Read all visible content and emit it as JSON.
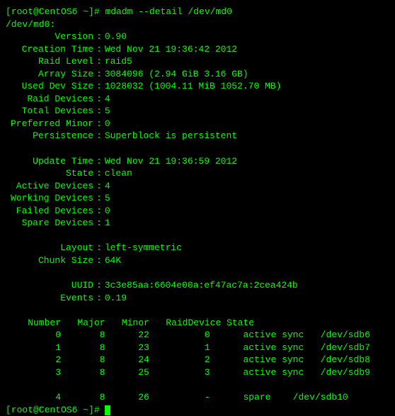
{
  "prompt1": {
    "user_host": "[root@CentOS6 ~]#",
    "command": "mdadm --detail /dev/md0"
  },
  "device_header": "/dev/md0:",
  "fields": {
    "version": {
      "label": "Version",
      "value": "0.90"
    },
    "creation_time": {
      "label": "Creation Time",
      "value": "Wed Nov 21 19:36:42 2012"
    },
    "raid_level": {
      "label": "Raid Level",
      "value": "raid5"
    },
    "array_size": {
      "label": "Array Size",
      "value": "3084096 (2.94 GiB 3.16 GB)"
    },
    "used_dev_size": {
      "label": "Used Dev Size",
      "value": "1028032 (1004.11 MiB 1052.70 MB)"
    },
    "raid_devices": {
      "label": "Raid Devices",
      "value": "4"
    },
    "total_devices": {
      "label": "Total Devices",
      "value": "5"
    },
    "preferred_minor": {
      "label": "Preferred Minor",
      "value": "0"
    },
    "persistence": {
      "label": "Persistence",
      "value": "Superblock is persistent"
    },
    "update_time": {
      "label": "Update Time",
      "value": "Wed Nov 21 19:36:59 2012"
    },
    "state": {
      "label": "State",
      "value": "clean"
    },
    "active_devices": {
      "label": "Active Devices",
      "value": "4"
    },
    "working_devices": {
      "label": "Working Devices",
      "value": "5"
    },
    "failed_devices": {
      "label": "Failed Devices",
      "value": "0"
    },
    "spare_devices": {
      "label": "Spare Devices",
      "value": "1"
    },
    "layout": {
      "label": "Layout",
      "value": "left-symmetric"
    },
    "chunk_size": {
      "label": "Chunk Size",
      "value": "64K"
    },
    "uuid": {
      "label": "UUID",
      "value": "3c3e85aa:6604e00a:ef47ac7a:2cea424b"
    },
    "events": {
      "label": "Events",
      "value": "0.19"
    }
  },
  "table": {
    "headers": {
      "number": "Number",
      "major": "Major",
      "minor": "Minor",
      "raid_device": "RaidDevice",
      "state": "State"
    },
    "rows": [
      {
        "number": "0",
        "major": "8",
        "minor": "22",
        "raid_device": "0",
        "state": "active sync",
        "dev": "/dev/sdb6"
      },
      {
        "number": "1",
        "major": "8",
        "minor": "23",
        "raid_device": "1",
        "state": "active sync",
        "dev": "/dev/sdb7"
      },
      {
        "number": "2",
        "major": "8",
        "minor": "24",
        "raid_device": "2",
        "state": "active sync",
        "dev": "/dev/sdb8"
      },
      {
        "number": "3",
        "major": "8",
        "minor": "25",
        "raid_device": "3",
        "state": "active sync",
        "dev": "/dev/sdb9"
      }
    ],
    "spare_row": {
      "number": "4",
      "major": "8",
      "minor": "26",
      "raid_device": "-",
      "state": "spare",
      "dev": "/dev/sdb10"
    }
  },
  "prompt2": {
    "user_host": "[root@CentOS6 ~]#"
  }
}
